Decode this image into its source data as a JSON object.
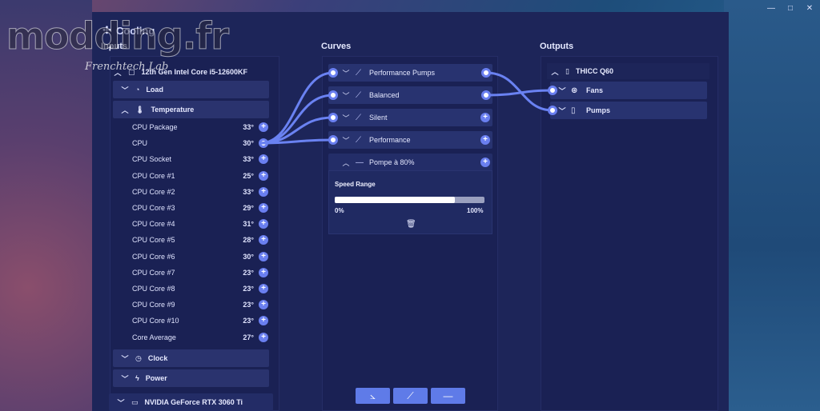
{
  "watermark": {
    "main": "modding.fr",
    "sub": "Frenchtech Lab"
  },
  "app": {
    "title": "Cooling"
  },
  "window_controls": {
    "minimize": "—",
    "maximize": "□",
    "close": "✕"
  },
  "columns": {
    "inputs": "Inputs",
    "curves": "Curves",
    "outputs": "Outputs"
  },
  "inputs": {
    "device": "12th Gen Intel Core i5-12600KF",
    "groups": {
      "load": "Load",
      "temperature": "Temperature",
      "clock": "Clock",
      "power": "Power"
    },
    "sensors": [
      {
        "name": "CPU Package",
        "value": "33°"
      },
      {
        "name": "CPU",
        "value": "30°"
      },
      {
        "name": "CPU Socket",
        "value": "33°"
      },
      {
        "name": "CPU Core #1",
        "value": "25°"
      },
      {
        "name": "CPU Core #2",
        "value": "33°"
      },
      {
        "name": "CPU Core #3",
        "value": "29°"
      },
      {
        "name": "CPU Core #4",
        "value": "31°"
      },
      {
        "name": "CPU Core #5",
        "value": "28°"
      },
      {
        "name": "CPU Core #6",
        "value": "30°"
      },
      {
        "name": "CPU Core #7",
        "value": "23°"
      },
      {
        "name": "CPU Core #8",
        "value": "23°"
      },
      {
        "name": "CPU Core #9",
        "value": "23°"
      },
      {
        "name": "CPU Core #10",
        "value": "23°"
      },
      {
        "name": "Core Average",
        "value": "27°"
      }
    ],
    "gpu_device": "NVIDIA GeForce RTX 3060 Ti"
  },
  "curves": {
    "items": [
      "Performance Pumps",
      "Balanced",
      "Silent",
      "Performance",
      "Pompe à 80%"
    ],
    "speed_range": {
      "title": "Speed Range",
      "min_label": "0%",
      "max_label": "100%",
      "value_fraction": 0.8
    }
  },
  "outputs": {
    "device": "THICC Q60",
    "items": [
      "Fans",
      "Pumps"
    ]
  },
  "colors": {
    "accent": "#6a7ff0",
    "panel": "#1a2154",
    "row": "#283370"
  }
}
